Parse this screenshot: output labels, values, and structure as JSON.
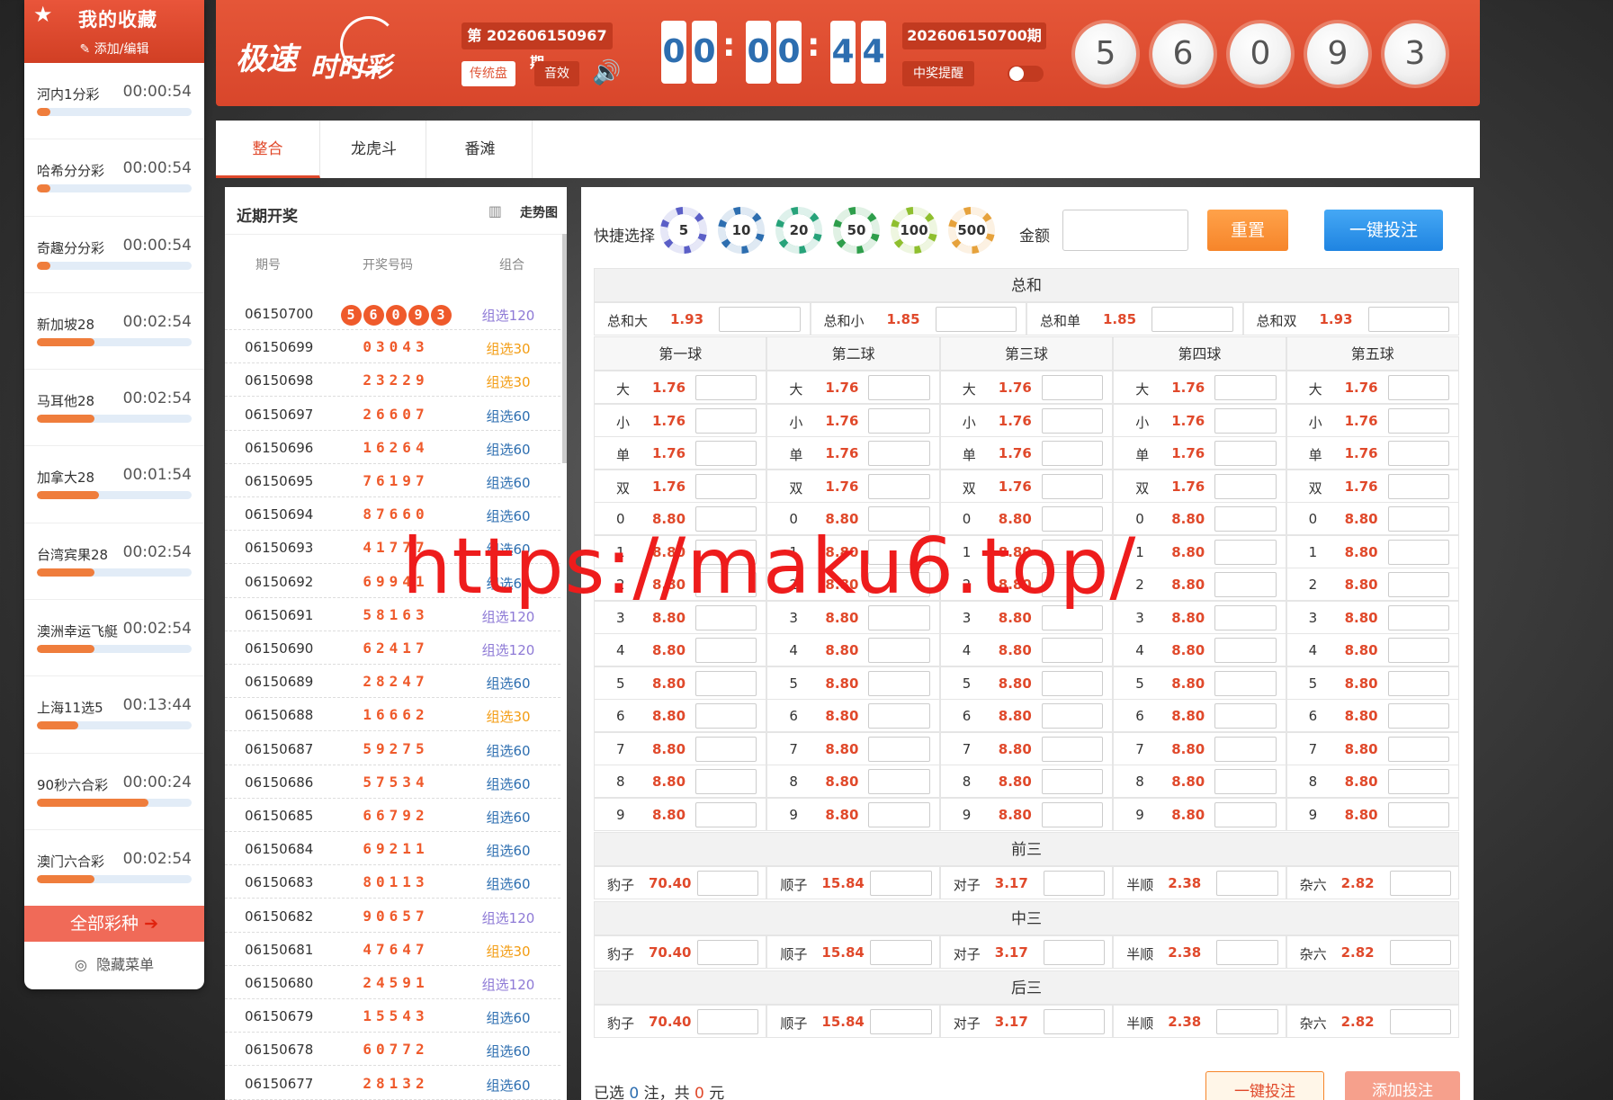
{
  "sidebar": {
    "title": "我的收藏",
    "edit_label": "添加/编辑",
    "items": [
      {
        "name": "河内1分彩",
        "time": "00:00:54",
        "progress": 0.09
      },
      {
        "name": "哈希分分彩",
        "time": "00:00:54",
        "progress": 0.09
      },
      {
        "name": "奇趣分分彩",
        "time": "00:00:54",
        "progress": 0.09
      },
      {
        "name": "新加坡28",
        "time": "00:02:54",
        "progress": 0.37
      },
      {
        "name": "马耳他28",
        "time": "00:02:54",
        "progress": 0.37
      },
      {
        "name": "加拿大28",
        "time": "00:01:54",
        "progress": 0.4
      },
      {
        "name": "台湾宾果28",
        "time": "00:02:54",
        "progress": 0.37
      },
      {
        "name": "澳洲幸运飞艇",
        "time": "00:02:54",
        "progress": 0.37
      },
      {
        "name": "上海11选5",
        "time": "00:13:44",
        "progress": 0.27
      },
      {
        "name": "90秒六合彩",
        "time": "00:00:24",
        "progress": 0.72
      },
      {
        "name": "澳门六合彩",
        "time": "00:02:54",
        "progress": 0.37
      }
    ],
    "all_label": "全部彩种",
    "hide_label": "隐藏菜单"
  },
  "header": {
    "logo_a": "极速",
    "logo_b": "时时彩",
    "current_period": "第 202606150967 期",
    "traditional_btn": "传统盘",
    "sound_btn": "音效",
    "countdown": [
      "0",
      "0",
      "0",
      "0",
      "4",
      "4"
    ],
    "colon": ":",
    "last_period": "202606150700期",
    "remind_label": "中奖提醒",
    "last_balls": [
      "5",
      "6",
      "0",
      "9",
      "3"
    ]
  },
  "tabs": [
    "整合",
    "龙虎斗",
    "番滩"
  ],
  "recent": {
    "title": "近期开奖",
    "trend_label": "走势图",
    "headers": [
      "期号",
      "开奖号码",
      "组合"
    ],
    "rows": [
      {
        "p": "06150700",
        "n": "56093",
        "g": "组选120",
        "balls": true
      },
      {
        "p": "06150699",
        "n": "03043",
        "g": "组选30"
      },
      {
        "p": "06150698",
        "n": "23229",
        "g": "组选30"
      },
      {
        "p": "06150697",
        "n": "26607",
        "g": "组选60"
      },
      {
        "p": "06150696",
        "n": "16264",
        "g": "组选60"
      },
      {
        "p": "06150695",
        "n": "76197",
        "g": "组选60"
      },
      {
        "p": "06150694",
        "n": "87660",
        "g": "组选60"
      },
      {
        "p": "06150693",
        "n": "41777",
        "g": "组选60"
      },
      {
        "p": "06150692",
        "n": "69941",
        "g": "组选60"
      },
      {
        "p": "06150691",
        "n": "58163",
        "g": "组选120"
      },
      {
        "p": "06150690",
        "n": "62417",
        "g": "组选120"
      },
      {
        "p": "06150689",
        "n": "28247",
        "g": "组选60"
      },
      {
        "p": "06150688",
        "n": "16662",
        "g": "组选30"
      },
      {
        "p": "06150687",
        "n": "59275",
        "g": "组选60"
      },
      {
        "p": "06150686",
        "n": "57534",
        "g": "组选60"
      },
      {
        "p": "06150685",
        "n": "66792",
        "g": "组选60"
      },
      {
        "p": "06150684",
        "n": "69211",
        "g": "组选60"
      },
      {
        "p": "06150683",
        "n": "80113",
        "g": "组选60"
      },
      {
        "p": "06150682",
        "n": "90657",
        "g": "组选120"
      },
      {
        "p": "06150681",
        "n": "47647",
        "g": "组选30"
      },
      {
        "p": "06150680",
        "n": "24591",
        "g": "组选120"
      },
      {
        "p": "06150679",
        "n": "15543",
        "g": "组选60"
      },
      {
        "p": "06150678",
        "n": "60772",
        "g": "组选60"
      },
      {
        "p": "06150677",
        "n": "28132",
        "g": "组选60"
      }
    ]
  },
  "bet": {
    "quick_label": "快捷选择",
    "chips": [
      "5",
      "10",
      "20",
      "50",
      "100",
      "500"
    ],
    "amount_label": "金额",
    "reset_label": "重置",
    "bet_label": "一键投注",
    "total_title": "总和",
    "total_items": [
      {
        "label": "总和大",
        "odds": "1.93"
      },
      {
        "label": "总和小",
        "odds": "1.85"
      },
      {
        "label": "总和单",
        "odds": "1.85"
      },
      {
        "label": "总和双",
        "odds": "1.93"
      }
    ],
    "ball_titles": [
      "第一球",
      "第二球",
      "第三球",
      "第四球",
      "第五球"
    ],
    "ball_rows": [
      {
        "label": "大",
        "odds": "1.76"
      },
      {
        "label": "小",
        "odds": "1.76"
      },
      {
        "label": "单",
        "odds": "1.76"
      },
      {
        "label": "双",
        "odds": "1.76"
      },
      {
        "label": "0",
        "odds": "8.80"
      },
      {
        "label": "1",
        "odds": "8.80"
      },
      {
        "label": "2",
        "odds": "8.80"
      },
      {
        "label": "3",
        "odds": "8.80"
      },
      {
        "label": "4",
        "odds": "8.80"
      },
      {
        "label": "5",
        "odds": "8.80"
      },
      {
        "label": "6",
        "odds": "8.80"
      },
      {
        "label": "7",
        "odds": "8.80"
      },
      {
        "label": "8",
        "odds": "8.80"
      },
      {
        "label": "9",
        "odds": "8.80"
      }
    ],
    "three_sections": [
      "前三",
      "中三",
      "后三"
    ],
    "three_items": [
      {
        "label": "豹子",
        "odds": "70.40"
      },
      {
        "label": "顺子",
        "odds": "15.84"
      },
      {
        "label": "对子",
        "odds": "3.17"
      },
      {
        "label": "半顺",
        "odds": "2.38"
      },
      {
        "label": "杂六",
        "odds": "2.82"
      }
    ],
    "selected_prefix": "已选",
    "selected_count": "0",
    "selected_mid": "注，共",
    "selected_amount": "0",
    "selected_suffix": "元",
    "bet_label2": "一键投注",
    "add_label": "添加投注"
  },
  "watermark": "https://maku6.top/",
  "colors": {
    "accent": "#e0492b",
    "blue": "#2d6eb0",
    "group30": "#f39c12",
    "group60": "#2d6eb0",
    "group120": "#8e7ad6"
  }
}
